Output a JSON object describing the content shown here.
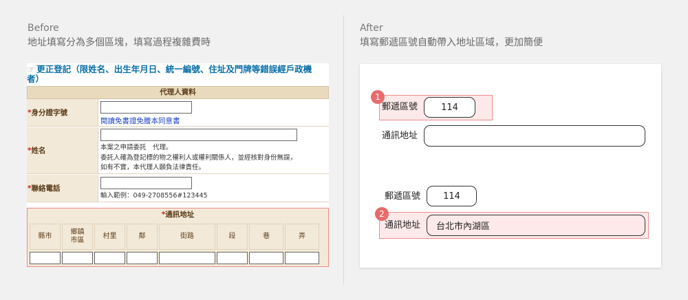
{
  "before": {
    "heading": "Before",
    "subheading": "地址填寫分為多個區塊，填寫過程複雜費時",
    "form": {
      "title_line1": "更正登記（限姓名、出生年月日、統一編號、住址及門牌等錯誤經戶政機",
      "title_line2": "者）",
      "section_header": "代理人資料",
      "id_label": "身分證字號",
      "id_link": "閱讀免書證免謄本同意書",
      "name_label": "姓名",
      "name_note": "本案之申請委託　代理。",
      "name_note2": "委託人確為登記標的物之權利人或權利關係人，並經核對身份無誤，",
      "name_note3": "如有不實，本代理人願負法律責任。",
      "phone_label": "聯絡電話",
      "phone_example": "輸入範例：049-2708556#123445",
      "address_header": "通訊地址",
      "address_columns": [
        "縣市",
        "鄉鎮\n市區",
        "村里",
        "鄰",
        "街路",
        "段",
        "巷",
        "弄"
      ]
    }
  },
  "after": {
    "heading": "After",
    "subheading": "填寫郵遞區號自動帶入地址區域，更加簡便",
    "step1": {
      "badge": "1",
      "postal_label": "郵遞區號",
      "postal_value": "114",
      "address_label": "通訊地址",
      "address_value": ""
    },
    "step2": {
      "badge": "2",
      "postal_label": "郵遞區號",
      "postal_value": "114",
      "address_label": "通訊地址",
      "address_value": "台北市內湖區"
    }
  },
  "colors": {
    "highlight_border": "#ef8c8c",
    "highlight_fill": "#fde9e9",
    "badge": "#e96b6b",
    "legacy_link": "#1a3fc0",
    "legacy_title": "#0a6fa8",
    "legacy_label_bg": "#f3e9d8"
  }
}
